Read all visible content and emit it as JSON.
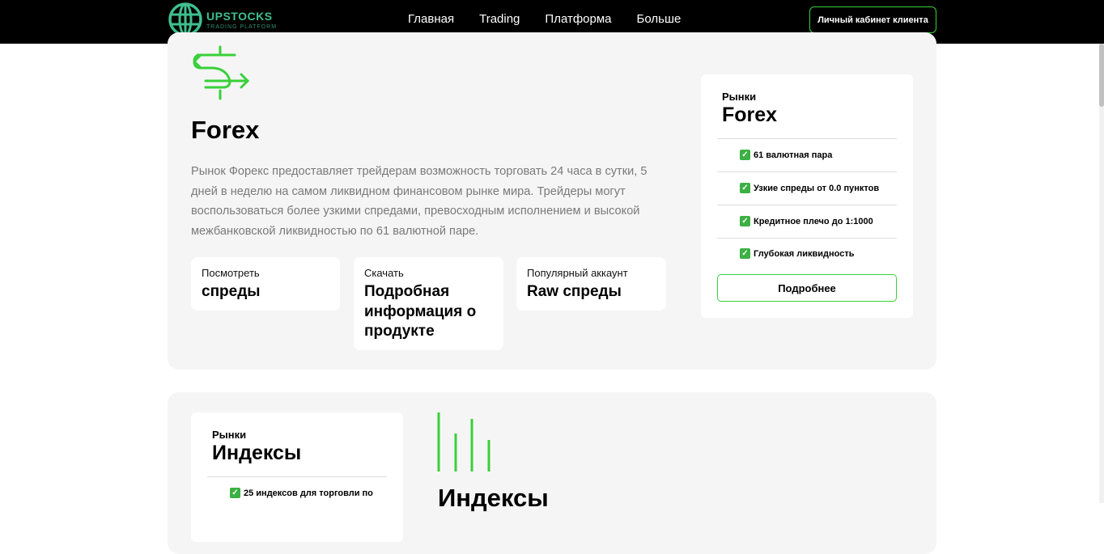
{
  "header": {
    "logo_name": "UPSTOCKS",
    "logo_sub": "TRADING PLATFORM",
    "nav": [
      "Главная",
      "Trading",
      "Платформа",
      "Больше"
    ],
    "cta": "Личный кабинет клиента"
  },
  "forex": {
    "title": "Forex",
    "description": "Рынок Форекс предоставляет трейдерам возможность торговать 24 часа в сутки, 5 дней в неделю на самом ликвидном финансовом рынке мира. Трейдеры могут воспользоваться более узкими спредами, превосходным исполнением и высокой межбанковской ликвидностью по 61 валютной паре.",
    "cards": [
      {
        "label": "Посмотреть",
        "value": "спреды"
      },
      {
        "label": "Скачать",
        "value": "Подробная информация о продукте"
      },
      {
        "label": "Популярный аккаунт",
        "value": "Raw спреды"
      }
    ],
    "side": {
      "kicker": "Рынки",
      "title": "Forex",
      "items": [
        "61 валютная пара",
        "Узкие спреды от 0.0 пунктов",
        "Кредитное плечо до 1:1000",
        "Глубокая ликвидность"
      ],
      "button": "Подробнее"
    }
  },
  "indices": {
    "title": "Индексы",
    "side": {
      "kicker": "Рынки",
      "title": "Индексы",
      "items": [
        "25 индексов для торговли по"
      ]
    }
  },
  "colors": {
    "accent": "#3ad03a",
    "logo": "#3fbf8f",
    "panel": "#f5f5f5"
  }
}
